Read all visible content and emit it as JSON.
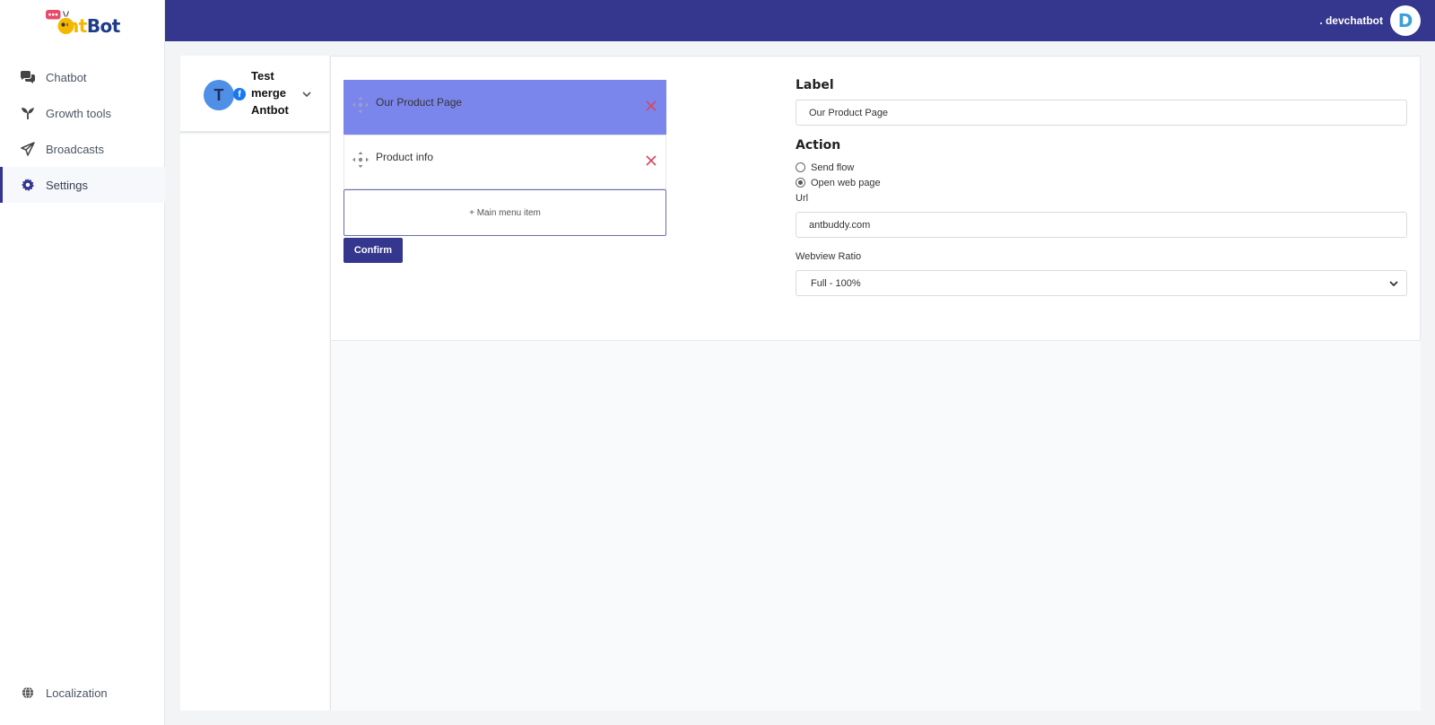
{
  "brand": {
    "logo_part1": "nt",
    "logo_part2": "Bot",
    "accent": "#35368e"
  },
  "topbar": {
    "username": ". devchatbot",
    "avatar_letter": "D"
  },
  "sidebar": {
    "items": [
      {
        "label": "Chatbot",
        "icon": "chat-bubbles-icon"
      },
      {
        "label": "Growth tools",
        "icon": "sprout-icon"
      },
      {
        "label": "Broadcasts",
        "icon": "paper-plane-icon"
      },
      {
        "label": "Settings",
        "icon": "gear-icon",
        "active": true
      }
    ],
    "bottom": {
      "label": "Localization",
      "icon": "globe-icon"
    }
  },
  "page_selector": {
    "initial": "T",
    "name": "Test merge Antbot"
  },
  "menu": {
    "items": [
      {
        "label": "Our Product Page",
        "selected": true
      },
      {
        "label": "Product info",
        "selected": false
      }
    ],
    "add_label": "+ Main menu item",
    "confirm_label": "Confirm"
  },
  "form": {
    "label_heading": "Label",
    "label_value": "Our Product Page",
    "action_heading": "Action",
    "action_options": [
      "Send flow",
      "Open web page"
    ],
    "action_selected": "Open web page",
    "url_label": "Url",
    "url_value": "antbuddy.com",
    "ratio_label": "Webview Ratio",
    "ratio_value": "Full - 100%"
  }
}
